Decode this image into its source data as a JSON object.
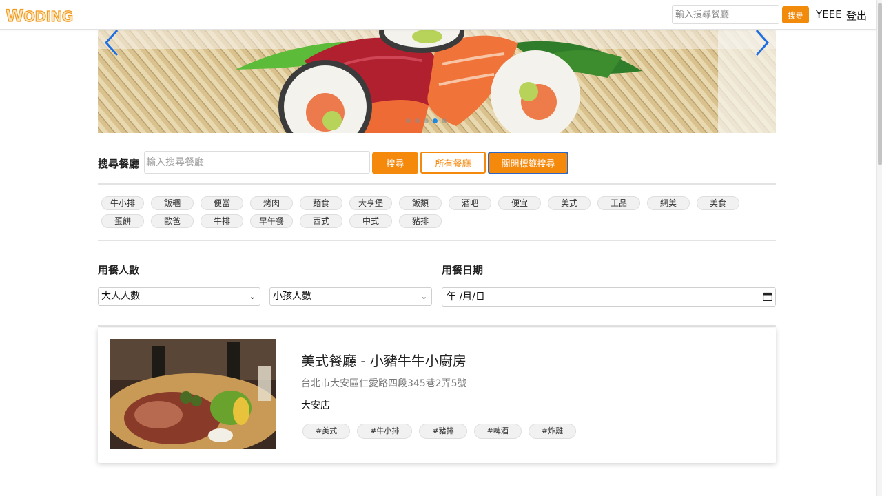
{
  "nav": {
    "logo": "WODING",
    "search_placeholder": "輸入搜尋餐廳",
    "search_button": "搜尋",
    "username": "YEEE",
    "logout": "登出"
  },
  "carousel": {
    "slide_count": 5,
    "active_index": 3,
    "prev_icon": "chevron-left-icon",
    "next_icon": "chevron-right-icon"
  },
  "search": {
    "label": "搜尋餐廳",
    "placeholder": "輸入搜尋餐廳",
    "search_button": "搜尋",
    "all_button": "所有餐廳",
    "close_tags_button": "關閉標籤搜尋"
  },
  "tags": [
    "牛小排",
    "飯糰",
    "便當",
    "烤肉",
    "麵食",
    "大亨堡",
    "飯類",
    "酒吧",
    "便宜",
    "美式",
    "王品",
    "網美",
    "美食",
    "蛋餅",
    "歐爸",
    "牛排",
    "早午餐",
    "西式",
    "中式",
    "豬排"
  ],
  "filters": {
    "party_label": "用餐人數",
    "adults_select": "大人人數",
    "kids_select": "小孩人數",
    "date_label": "用餐日期",
    "date_value": "年 /月/日"
  },
  "restaurant": {
    "title": "美式餐廳 - 小豬牛牛小廚房",
    "address": "台北市大安區仁愛路四段345巷2弄5號",
    "branch": "大安店",
    "tags": [
      "#美式",
      "#牛小排",
      "#豬排",
      "#啤酒",
      "#炸雞"
    ]
  },
  "colors": {
    "accent": "#f5890c",
    "focus_border": "#2a67c7",
    "carousel_active_dot": "#1e88e5"
  }
}
